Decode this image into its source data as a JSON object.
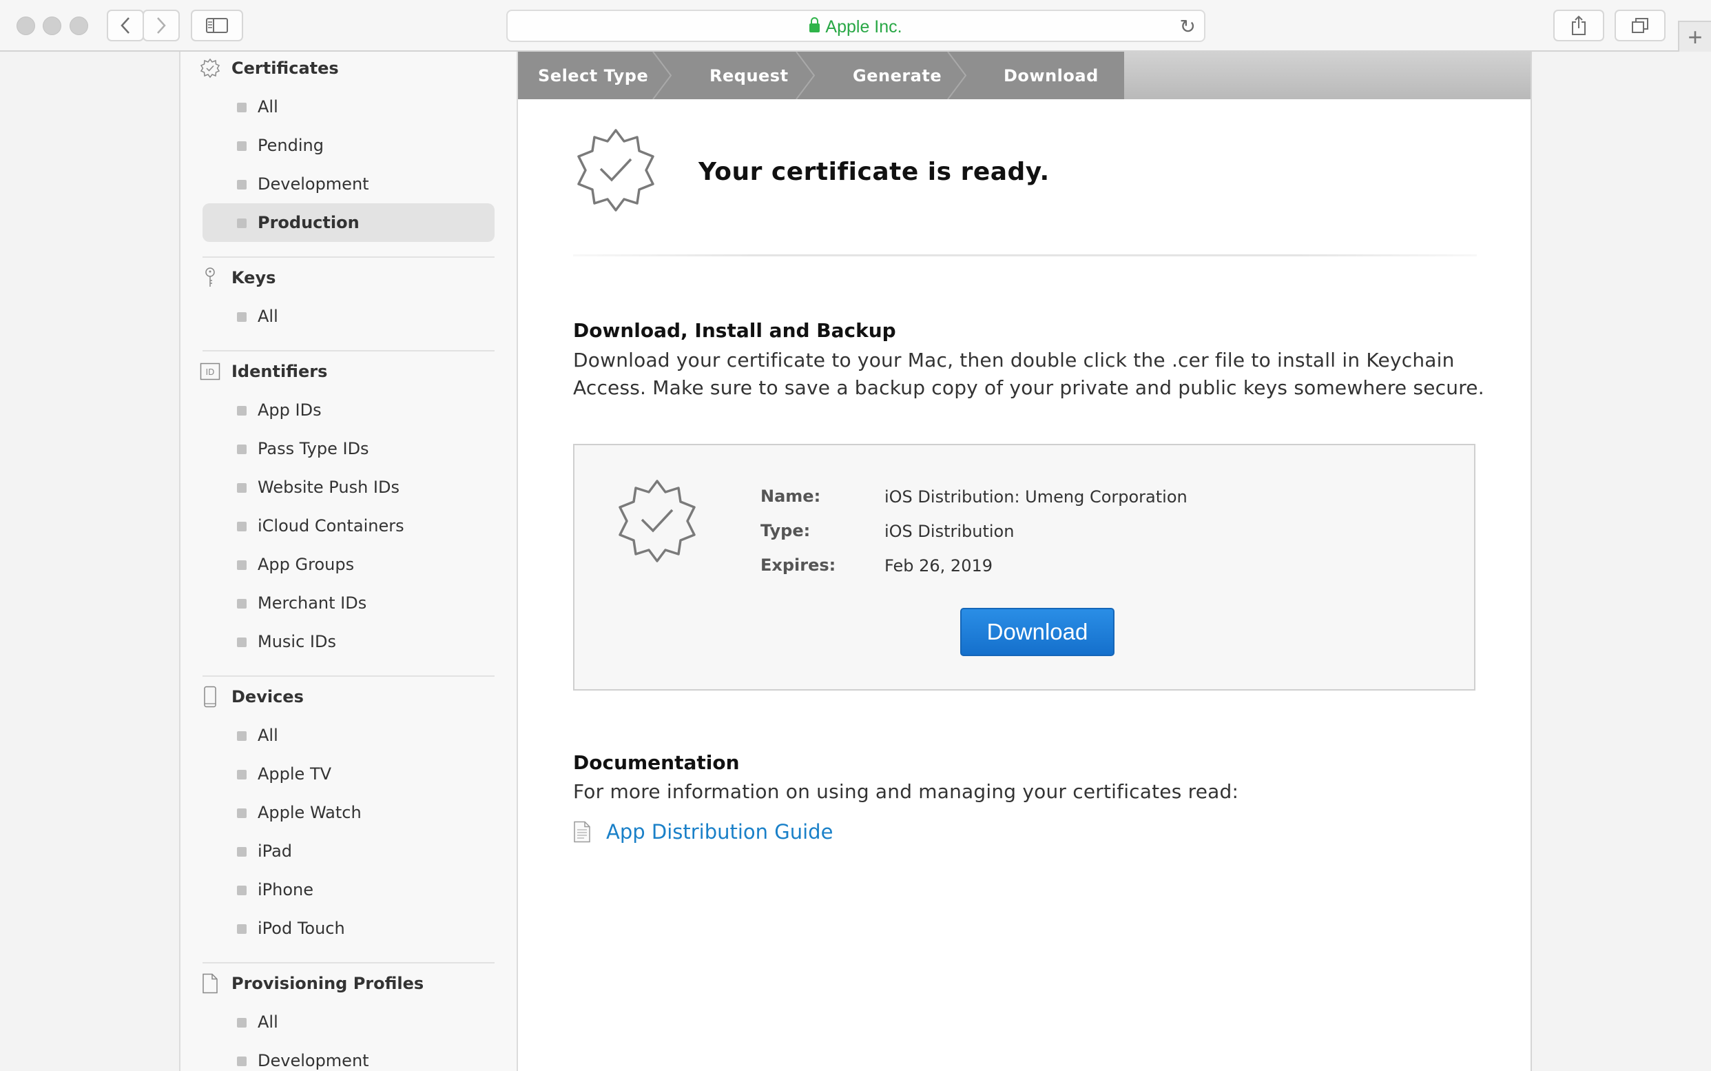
{
  "browser": {
    "address": "Apple Inc.",
    "back_icon": "chevron-left-icon",
    "forward_icon": "chevron-right-icon",
    "sidebar_icon": "sidebar-icon",
    "share_icon": "share-icon",
    "tabs_icon": "tabs-icon",
    "new_tab": "+"
  },
  "sidebar": {
    "certificates": {
      "title": "Certificates",
      "items": [
        "All",
        "Pending",
        "Development",
        "Production"
      ],
      "active": "Production"
    },
    "keys": {
      "title": "Keys",
      "items": [
        "All"
      ]
    },
    "identifiers": {
      "title": "Identifiers",
      "icon_text": "ID",
      "items": [
        "App IDs",
        "Pass Type IDs",
        "Website Push IDs",
        "iCloud Containers",
        "App Groups",
        "Merchant IDs",
        "Music IDs"
      ]
    },
    "devices": {
      "title": "Devices",
      "items": [
        "All",
        "Apple TV",
        "Apple Watch",
        "iPad",
        "iPhone",
        "iPod Touch"
      ]
    },
    "profiles": {
      "title": "Provisioning Profiles",
      "items": [
        "All",
        "Development"
      ]
    }
  },
  "steps": [
    "Select Type",
    "Request",
    "Generate",
    "Download"
  ],
  "main": {
    "title": "Your certificate is ready.",
    "install_heading": "Download, Install and Backup",
    "install_line1": "Download your certificate to your Mac, then double click the .cer file to install in Keychain",
    "install_line2": "Access. Make sure to save a backup copy of your private and public keys somewhere secure.",
    "cert": {
      "name_label": "Name:",
      "name_value": "iOS Distribution: Umeng Corporation",
      "type_label": "Type:",
      "type_value": "iOS Distribution",
      "expires_label": "Expires:",
      "expires_value": "Feb 26, 2019"
    },
    "download_button": "Download",
    "doc_heading": "Documentation",
    "doc_text": "For more information on using and managing your certificates read:",
    "doc_link": "App Distribution Guide"
  },
  "colors": {
    "accent_blue": "#1a80c8",
    "button_blue": "#1f7fdc",
    "secure_green": "#28a745",
    "step_bar": "#8f8f8f"
  }
}
